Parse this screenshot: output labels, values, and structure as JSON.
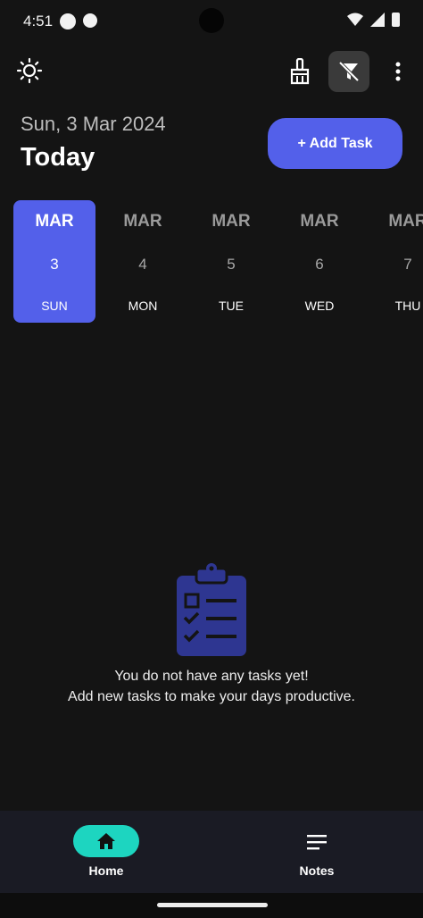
{
  "status": {
    "time": "4:51"
  },
  "header": {
    "date": "Sun, 3 Mar 2024",
    "title": "Today",
    "add_task_label": "+ Add Task"
  },
  "toolbar": {
    "icons": [
      "brightness-icon",
      "broom-icon",
      "filter-off-icon",
      "more-vert-icon"
    ]
  },
  "days": [
    {
      "month": "MAR",
      "day": "3",
      "weekday": "SUN",
      "selected": true
    },
    {
      "month": "MAR",
      "day": "4",
      "weekday": "MON",
      "selected": false
    },
    {
      "month": "MAR",
      "day": "5",
      "weekday": "TUE",
      "selected": false
    },
    {
      "month": "MAR",
      "day": "6",
      "weekday": "WED",
      "selected": false
    },
    {
      "month": "MAR",
      "day": "7",
      "weekday": "THU",
      "selected": false
    }
  ],
  "empty_state": {
    "line1": "You do not have any tasks yet!",
    "line2": "Add new tasks to make your days productive."
  },
  "nav": {
    "home_label": "Home",
    "notes_label": "Notes"
  },
  "colors": {
    "accent": "#5360ea",
    "home_pill": "#1dd5c0",
    "background": "#141414"
  }
}
